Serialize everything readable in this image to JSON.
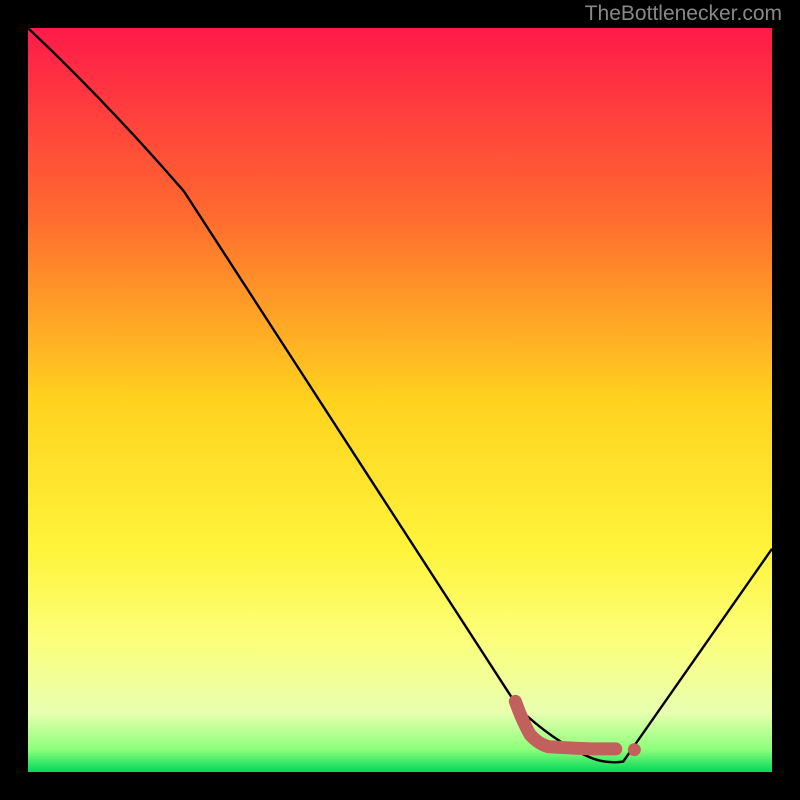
{
  "watermark": "TheBottlenecker.com",
  "chart_data": {
    "type": "line",
    "title": "",
    "xlabel": "",
    "ylabel": "",
    "xlim": [
      0,
      100
    ],
    "ylim": [
      0,
      100
    ],
    "gradient_stops": [
      {
        "offset": 0,
        "color": "#ff1a4a"
      },
      {
        "offset": 25,
        "color": "#ff6a2f"
      },
      {
        "offset": 50,
        "color": "#ffd21e"
      },
      {
        "offset": 70,
        "color": "#fff43a"
      },
      {
        "offset": 82,
        "color": "#fcff7a"
      },
      {
        "offset": 92,
        "color": "#e8ffb0"
      },
      {
        "offset": 97,
        "color": "#8cff7a"
      },
      {
        "offset": 100,
        "color": "#00d85a"
      }
    ],
    "series": [
      {
        "name": "bottleneck-curve",
        "color": "#000000",
        "points": [
          {
            "x": 0,
            "y": 100
          },
          {
            "x": 21,
            "y": 78
          },
          {
            "x": 66,
            "y": 8.5
          },
          {
            "x": 75,
            "y": 2.2
          },
          {
            "x": 80,
            "y": 1.4
          },
          {
            "x": 100,
            "y": 30
          }
        ]
      }
    ],
    "marker_path": {
      "name": "optimal-marker",
      "color": "#c1605c",
      "points": [
        {
          "x": 65.5,
          "y": 9.5
        },
        {
          "x": 67.5,
          "y": 5.0
        },
        {
          "x": 70.0,
          "y": 3.4
        },
        {
          "x": 73.5,
          "y": 3.2
        },
        {
          "x": 76.0,
          "y": 3.1
        },
        {
          "x": 79.0,
          "y": 3.1
        }
      ],
      "extra_dot": {
        "x": 81.5,
        "y": 3.0
      }
    }
  }
}
